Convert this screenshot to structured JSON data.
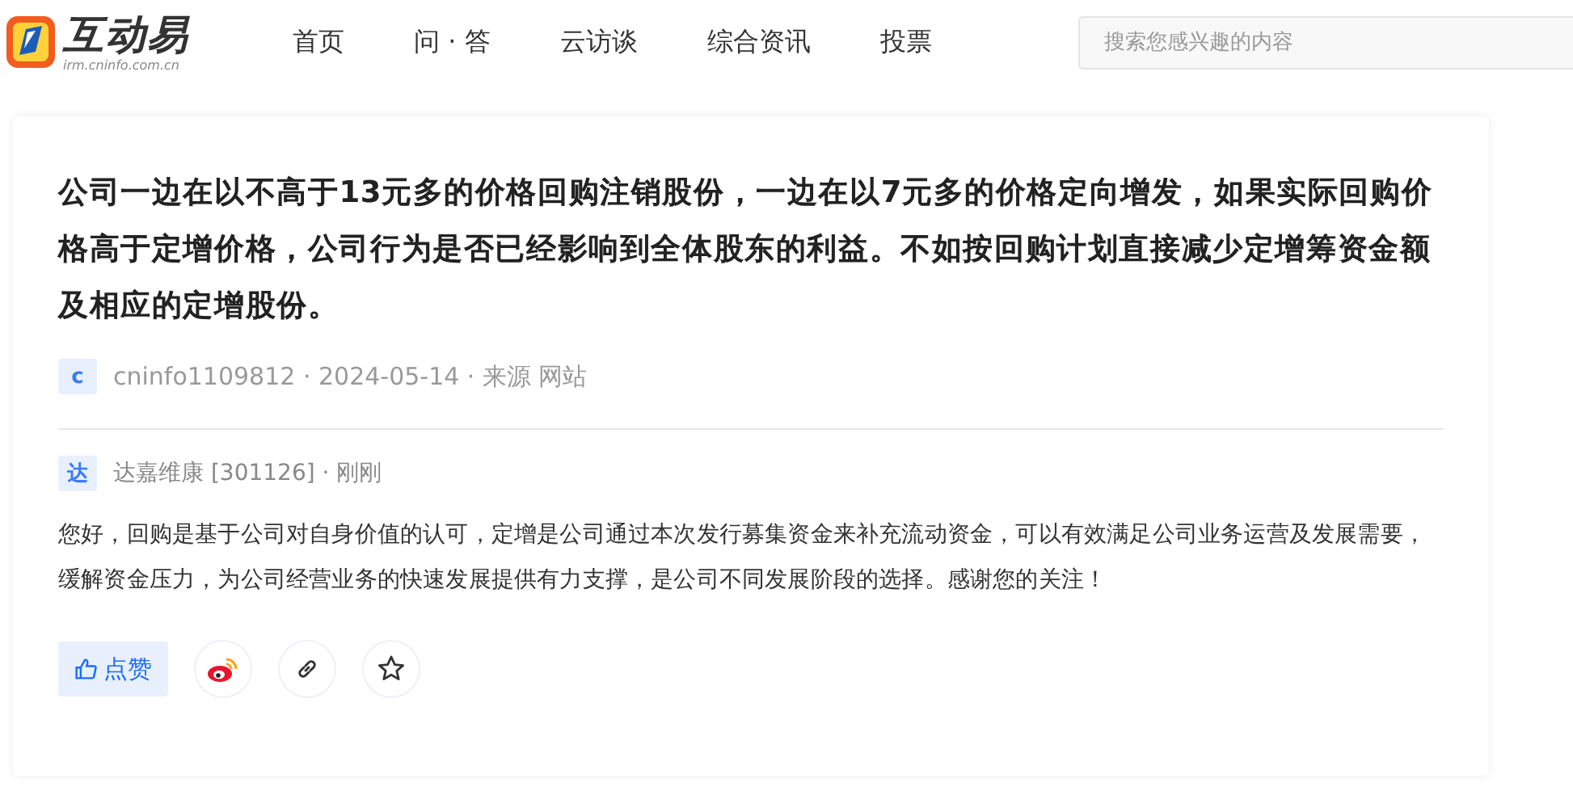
{
  "header": {
    "logo_text": "互动易",
    "logo_url": "irm.cninfo.com.cn",
    "nav": [
      {
        "label": "首页"
      },
      {
        "label": "问 · 答"
      },
      {
        "label": "云访谈"
      },
      {
        "label": "综合资讯"
      },
      {
        "label": "投票"
      }
    ],
    "search": {
      "placeholder": "搜索您感兴趣的内容"
    }
  },
  "question": {
    "text": "公司一边在以不高于13元多的价格回购注销股份，一边在以7元多的价格定向增发，如果实际回购价格高于定增价格，公司行为是否已经影响到全体股东的利益。不如按回购计划直接减少定增筹资金额及相应的定增股份。",
    "avatar": "c",
    "meta": "cninfo1109812 · 2024-05-14 · 来源 网站"
  },
  "answer": {
    "avatar": "达",
    "meta": "达嘉维康 [301126] · 刚刚",
    "text": "您好，回购是基于公司对自身价值的认可，定增是公司通过本次发行募集资金来补充流动资金，可以有效满足公司业务运营及发展需要，缓解资金压力，为公司经营业务的快速发展提供有力支撑，是公司不同发展阶段的选择。感谢您的关注！"
  },
  "actions": [
    {
      "kind": "like",
      "label": "点赞"
    },
    {
      "kind": "weibo"
    },
    {
      "kind": "link"
    },
    {
      "kind": "star"
    }
  ]
}
